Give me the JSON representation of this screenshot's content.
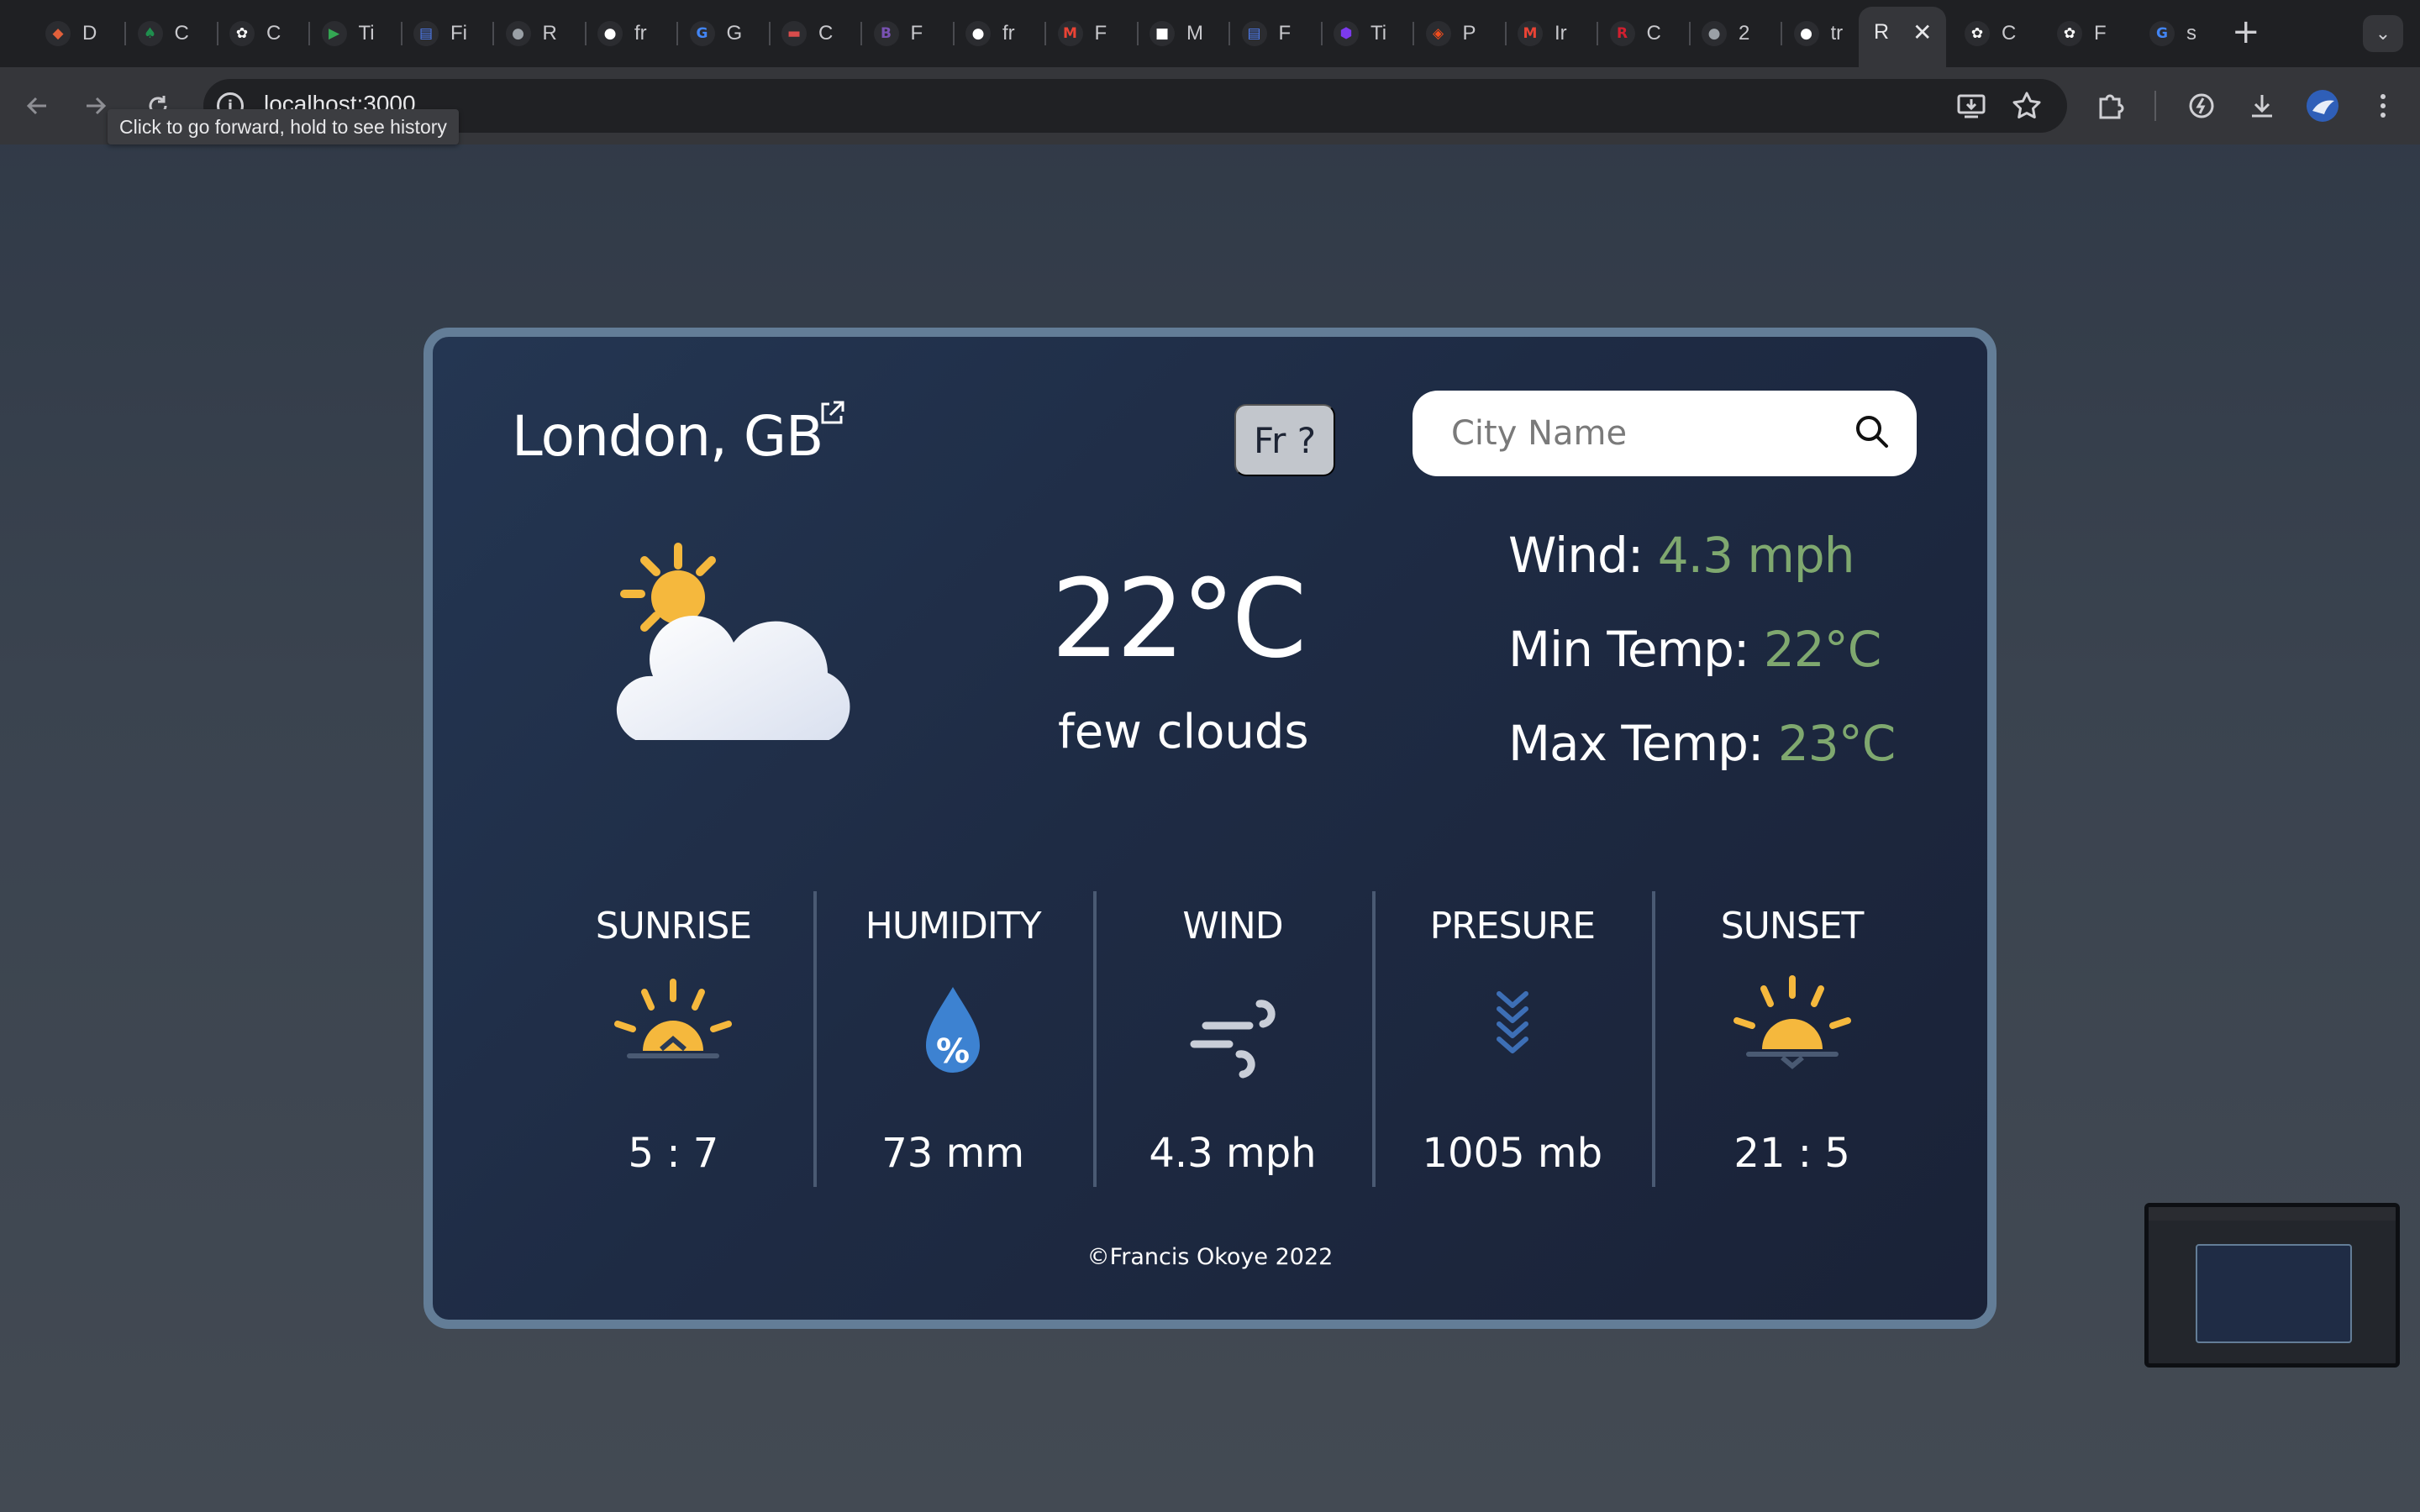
{
  "browser": {
    "tabs": [
      {
        "label": "D",
        "icon": "app-icon",
        "color": "#e2603b"
      },
      {
        "label": "C",
        "icon": "leaf-icon",
        "color": "#1f8f4e"
      },
      {
        "label": "C",
        "icon": "openai-icon",
        "color": "#ffffff"
      },
      {
        "label": "Ti",
        "icon": "play-store-icon",
        "color": "#34a853"
      },
      {
        "label": "Fi",
        "icon": "printer-icon",
        "color": "#4f7ef2"
      },
      {
        "label": "R",
        "icon": "globe-icon",
        "color": "#9aa0a6"
      },
      {
        "label": "fr",
        "icon": "github-icon",
        "color": "#ffffff"
      },
      {
        "label": "G",
        "icon": "google-icon",
        "color": "#4285f4"
      },
      {
        "label": "C",
        "icon": "car-icon",
        "color": "#d94c4c"
      },
      {
        "label": "F",
        "icon": "bootstrap-icon",
        "color": "#7952b3"
      },
      {
        "label": "fr",
        "icon": "github-icon",
        "color": "#ffffff"
      },
      {
        "label": "F",
        "icon": "gmail-icon",
        "color": "#ea4335"
      },
      {
        "label": "M",
        "icon": "frame-icon",
        "color": "#ffffff"
      },
      {
        "label": "F",
        "icon": "printer-icon",
        "color": "#4f7ef2"
      },
      {
        "label": "Ti",
        "icon": "shield-icon",
        "color": "#7c3aed"
      },
      {
        "label": "P",
        "icon": "figma-icon",
        "color": "#f24e1e"
      },
      {
        "label": "Ir",
        "icon": "gmail-icon",
        "color": "#ea4335"
      },
      {
        "label": "C",
        "icon": "r-icon",
        "color": "#d11f2f"
      },
      {
        "label": "2",
        "icon": "globe-icon",
        "color": "#9aa0a6"
      },
      {
        "label": "tr",
        "icon": "github-icon",
        "color": "#ffffff"
      }
    ],
    "active_tab": {
      "label": "R",
      "close": "✕"
    },
    "trailing_tabs": [
      {
        "label": "C",
        "icon": "openai-icon",
        "color": "#ffffff"
      },
      {
        "label": "F",
        "icon": "openai-icon",
        "color": "#ffffff"
      },
      {
        "label": "s",
        "icon": "google-icon",
        "color": "#4285f4"
      }
    ],
    "new_tab": "+",
    "tab_search": "⌄",
    "url": "localhost:3000",
    "tooltip": "Click to go forward, hold to see history"
  },
  "weather": {
    "city": "London, GB",
    "language_button": "Fr ?",
    "search_placeholder": "City Name",
    "search_value": "",
    "temperature": "22°C",
    "description": "few clouds",
    "wind_label": "Wind:",
    "wind_value": "4.3 mph",
    "min_label": "Min Temp:",
    "min_value": "22°C",
    "max_label": "Max Temp:",
    "max_value": "23°C",
    "metrics": [
      {
        "label": "SUNRISE",
        "value": "5 : 7",
        "icon": "sunrise-icon"
      },
      {
        "label": "HUMIDITY",
        "value": "73 mm",
        "icon": "humidity-drop-icon"
      },
      {
        "label": "WIND",
        "value": "4.3 mph",
        "icon": "wind-icon"
      },
      {
        "label": "PRESURE",
        "value": "1005 mb",
        "icon": "pressure-chevrons-icon"
      },
      {
        "label": "SUNSET",
        "value": "21 : 5",
        "icon": "sunset-icon"
      }
    ],
    "footer": "©Francis Okoye 2022",
    "colors": {
      "accent_green": "#7fa86f",
      "card_border": "#637d97",
      "sun": "#f5b83d"
    }
  }
}
